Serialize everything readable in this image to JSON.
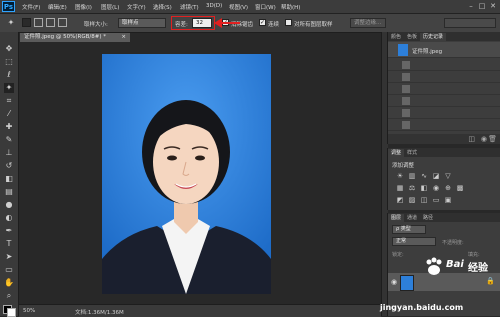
{
  "app": {
    "logo": "Ps"
  },
  "menu": [
    "文件(F)",
    "编辑(E)",
    "图像(I)",
    "图层(L)",
    "文字(Y)",
    "选择(S)",
    "滤镜(T)",
    "3D(D)",
    "视图(V)",
    "窗口(W)",
    "帮助(H)"
  ],
  "window_controls": {
    "minimize": "–",
    "maximize": "□",
    "close": "✕"
  },
  "options": {
    "sample_size_label": "取样大小:",
    "sample_size_value": "取样点",
    "tolerance_label": "容差:",
    "tolerance_value": "32",
    "anti_alias_label": "消除锯齿",
    "contiguous_label": "连续",
    "all_layers_label": "对所有图层取样",
    "refine_edge_label": "调整边缘..."
  },
  "document": {
    "tab_label": "证件照.jpeg @ 50%(RGB/8#) *",
    "close": "×"
  },
  "status": {
    "zoom": "50%",
    "doc_info": "文档:1.36M/1.36M"
  },
  "history_panel": {
    "tabs": [
      "颜色",
      "色板",
      "历史记录"
    ],
    "snapshot_label": "证件照.jpeg",
    "rows": 10
  },
  "adjust_panel": {
    "tabs": [
      "调整",
      "样式"
    ],
    "title": "添加调整"
  },
  "layers_panel": {
    "tabs": [
      "图层",
      "通道",
      "路径"
    ],
    "kind_label": "ρ 类型",
    "blend_mode": "正常",
    "opacity_label": "不透明度:",
    "lock_label": "锁定:",
    "fill_label": "填充:"
  },
  "watermark": {
    "brand": "Bai",
    "brand_cn": "经验",
    "url": "jingyan.baidu.com"
  },
  "colors": {
    "photo_bg": "#2d7fd9",
    "highlight": "#e02020"
  }
}
